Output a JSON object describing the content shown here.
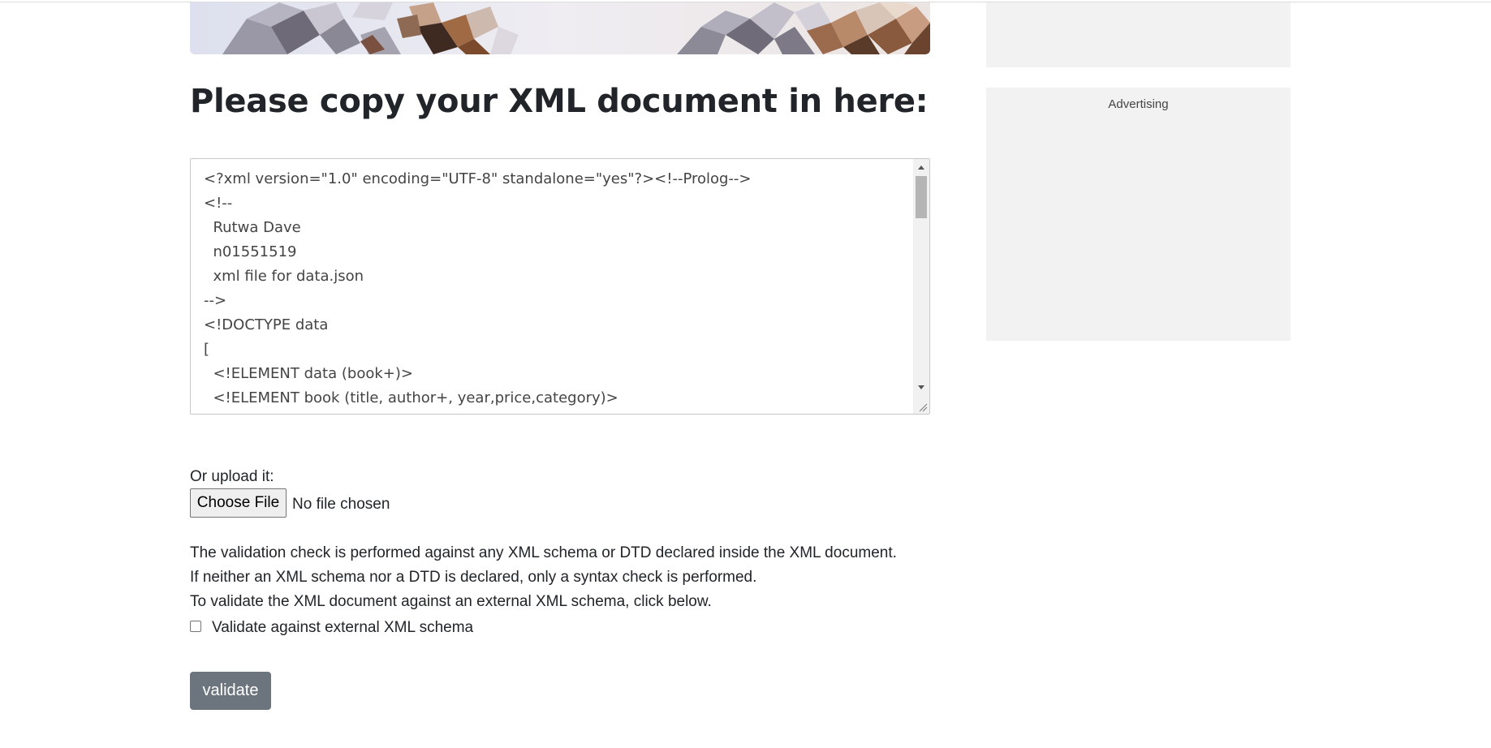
{
  "page": {
    "heading": "Please copy your XML document in here:"
  },
  "xml_input": {
    "lines": [
      "<?xml version=\"1.0\" encoding=\"UTF-8\" standalone=\"yes\"?><!--Prolog-->",
      "<!--",
      "  Rutwa Dave",
      "  n01551519",
      "  xml file for data.json",
      "-->",
      "<!DOCTYPE data",
      "[",
      "  <!ELEMENT data (book+)>",
      "  <!ELEMENT book (title, author+, year,price,category)>"
    ]
  },
  "upload": {
    "label": "Or upload it:",
    "button_label": "Choose File",
    "status": "No file chosen"
  },
  "info": {
    "line1": "The validation check is performed against any XML schema or DTD declared inside the XML document.",
    "line2": "If neither an XML schema nor a DTD is declared, only a syntax check is performed.",
    "line3": "To validate the XML document against an external XML schema, click below."
  },
  "external_schema": {
    "label": "Validate against external XML schema",
    "checked": false
  },
  "actions": {
    "validate_label": "validate"
  },
  "sidebar": {
    "ad_label": "Advertising"
  },
  "colors": {
    "button_bg": "#6c757d",
    "sidebar_bg": "#f2f2f2",
    "text": "#212529"
  }
}
